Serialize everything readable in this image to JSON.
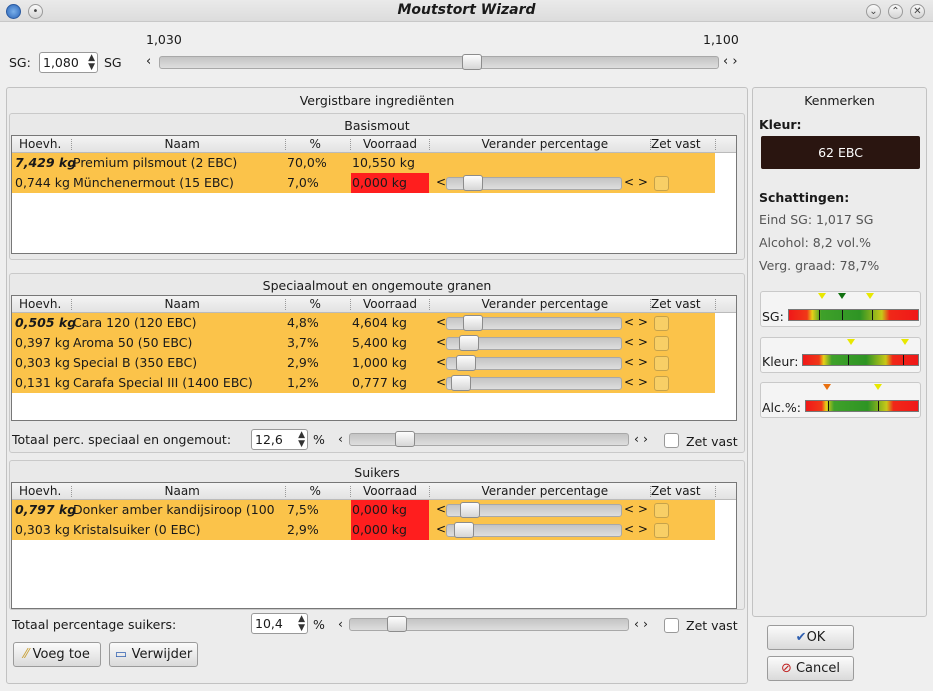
{
  "window": {
    "title": "Moutstort Wizard"
  },
  "sg_bar": {
    "label": "SG:",
    "value": "1,080",
    "unit": "SG",
    "min_label": "1,030",
    "max_label": "1,100",
    "position": 0.56
  },
  "fermentables": {
    "title": "Vergistbare ingrediënten",
    "columns": [
      "Hoevh.",
      "Naam",
      "%",
      "Voorraad",
      "Verander percentage",
      "Zet vast"
    ],
    "base": {
      "title": "Basismout",
      "rows": [
        {
          "amount": "7,429 kg",
          "name": "Premium pilsmout (2 EBC)",
          "pct": "70,0%",
          "stock": "10,550 kg",
          "stock_red": false,
          "slider": null,
          "bold": true
        },
        {
          "amount": "0,744 kg",
          "name": "Münchenermout (15 EBC)",
          "pct": "7,0%",
          "stock": "0,000 kg",
          "stock_red": true,
          "slider": 0.1,
          "bold": false
        }
      ]
    },
    "special": {
      "title": "Speciaalmout en ongemoute granen",
      "rows": [
        {
          "amount": "0,505 kg",
          "name": "Cara 120 (120 EBC)",
          "pct": "4,8%",
          "stock": "4,604 kg",
          "stock_red": false,
          "slider": 0.1,
          "bold": true
        },
        {
          "amount": "0,397 kg",
          "name": "Aroma 50 (50 EBC)",
          "pct": "3,7%",
          "stock": "5,400 kg",
          "stock_red": false,
          "slider": 0.07,
          "bold": false
        },
        {
          "amount": "0,303 kg",
          "name": "Special B (350 EBC)",
          "pct": "2,9%",
          "stock": "1,000 kg",
          "stock_red": false,
          "slider": 0.05,
          "bold": false
        },
        {
          "amount": "0,131 kg",
          "name": "Carafa Special III (1400 EBC)",
          "pct": "1,2%",
          "stock": "0,777 kg",
          "stock_red": false,
          "slider": 0.02,
          "bold": false
        }
      ],
      "total_label": "Totaal perc. speciaal en ongemout:",
      "total_value": "12,6",
      "total_unit": "%",
      "total_slider": 0.17,
      "lock_label": "Zet vast"
    },
    "sugars": {
      "title": "Suikers",
      "rows": [
        {
          "amount": "0,797 kg",
          "name": "Donker amber kandijsiroop (100",
          "pct": "7,5%",
          "stock": "0,000 kg",
          "stock_red": true,
          "slider": 0.08,
          "bold": true
        },
        {
          "amount": "0,303 kg",
          "name": "Kristalsuiker (0 EBC)",
          "pct": "2,9%",
          "stock": "0,000 kg",
          "stock_red": true,
          "slider": 0.04,
          "bold": false
        }
      ],
      "total_label": "Totaal percentage suikers:",
      "total_value": "10,4",
      "total_unit": "%",
      "total_slider": 0.14,
      "lock_label": "Zet vast"
    }
  },
  "buttons": {
    "add": "Voeg toe",
    "remove": "Verwijder",
    "ok": "OK",
    "cancel": "Cancel"
  },
  "properties": {
    "title": "Kenmerken",
    "color_label": "Kleur:",
    "color_value": "62 EBC",
    "color_hex": "#2a1510",
    "estimates_label": "Schattingen:",
    "estimates": [
      "Eind SG: 1,017 SG",
      "Alcohol: 8,2 vol.%",
      "Verg. graad: 78,7%"
    ],
    "gauges": [
      {
        "label": "SG:"
      },
      {
        "label": "Kleur:"
      },
      {
        "label": "Alc.%:"
      }
    ]
  }
}
